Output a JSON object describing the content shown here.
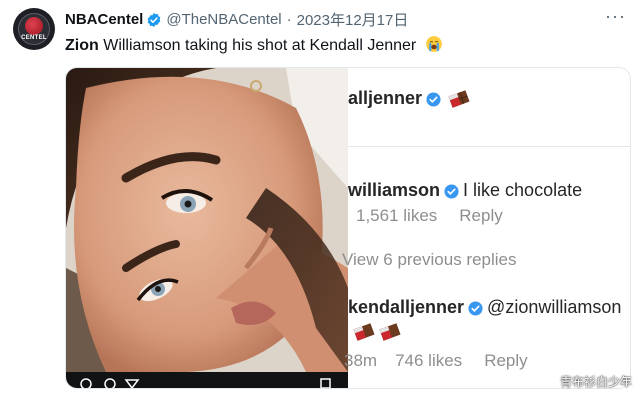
{
  "tweet": {
    "author_name": "NBACentel",
    "handle": "@TheNBACentel",
    "separator": "·",
    "date": "2023年12月17日",
    "text_first": "Zion",
    "text_rest": " Williamson taking his shot at Kendall Jenner",
    "avatar_word": "CENTEL",
    "more_label": "···"
  },
  "comments_panel": {
    "post_username": "alljenner",
    "comment1": {
      "username": "williamson",
      "text": "I like chocolate",
      "likes": "1,561 likes",
      "reply": "Reply"
    },
    "view_replies": "View 6 previous replies",
    "comment2": {
      "username": "kendalljenner",
      "mention": "@zionwilliamson",
      "time": "38m",
      "likes": "746 likes",
      "reply": "Reply"
    }
  },
  "watermark": "青布衫白少年",
  "colors": {
    "verified_blue": "#1d9bf0",
    "ig_verified_blue": "#3897f0",
    "text_gray": "#536471"
  }
}
